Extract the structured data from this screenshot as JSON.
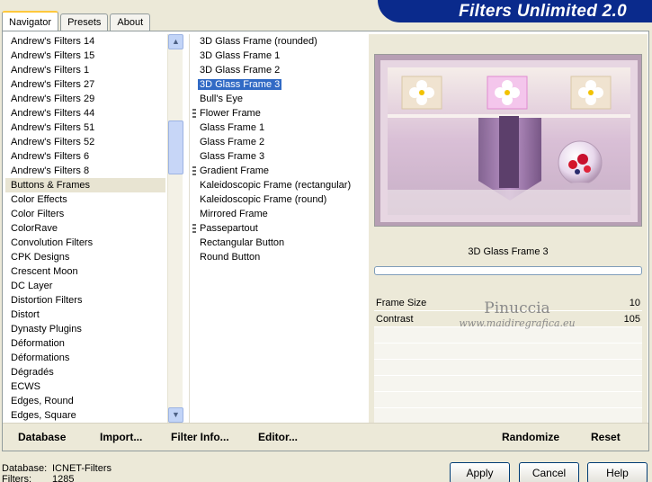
{
  "tabs": [
    "Navigator",
    "Presets",
    "About"
  ],
  "banner_title": "Filters Unlimited 2.0",
  "categories": [
    "Andrew's Filters 14",
    "Andrew's Filters 15",
    "Andrew's Filters 1",
    "Andrew's Filters 27",
    "Andrew's Filters 29",
    "Andrew's Filters 44",
    "Andrew's Filters 51",
    "Andrew's Filters 52",
    "Andrew's Filters 6",
    "Andrew's Filters 8",
    "Buttons & Frames",
    "Color Effects",
    "Color Filters",
    "ColorRave",
    "Convolution Filters",
    "CPK Designs",
    "Crescent Moon",
    "DC Layer",
    "Distortion Filters",
    "Distort",
    "Dynasty Plugins",
    "Déformation",
    "Déformations",
    "Dégradés",
    "ECWS",
    "Edges, Round",
    "Edges, Square"
  ],
  "selected_category_index": 10,
  "filters": [
    {
      "label": "3D Glass Frame (rounded)",
      "group": false
    },
    {
      "label": "3D Glass Frame 1",
      "group": false
    },
    {
      "label": "3D Glass Frame 2",
      "group": false
    },
    {
      "label": "3D Glass Frame 3",
      "group": false,
      "selected": true
    },
    {
      "label": "Bull's Eye",
      "group": false
    },
    {
      "label": "Flower Frame",
      "group": true
    },
    {
      "label": "Glass Frame 1",
      "group": false
    },
    {
      "label": "Glass Frame 2",
      "group": false
    },
    {
      "label": "Glass Frame 3",
      "group": false
    },
    {
      "label": "Gradient Frame",
      "group": true
    },
    {
      "label": "Kaleidoscopic Frame (rectangular)",
      "group": false
    },
    {
      "label": "Kaleidoscopic Frame (round)",
      "group": false
    },
    {
      "label": "Mirrored Frame",
      "group": false
    },
    {
      "label": "Passepartout",
      "group": true
    },
    {
      "label": "Rectangular Button",
      "group": false
    },
    {
      "label": "Round Button",
      "group": false
    }
  ],
  "preview": {
    "filter_name": "3D Glass Frame 3"
  },
  "params": [
    {
      "name": "Frame Size",
      "value": "10"
    },
    {
      "name": "Contrast",
      "value": "105"
    }
  ],
  "watermark": {
    "line1": "Pinuccia",
    "line2": "www.maidiregrafica.eu"
  },
  "bottom_links": {
    "database": "Database",
    "import": "Import...",
    "filter_info": "Filter Info...",
    "editor": "Editor...",
    "randomize": "Randomize",
    "reset": "Reset"
  },
  "status": {
    "database_label": "Database:",
    "database_value": "ICNET-Filters",
    "filters_label": "Filters:",
    "filters_value": "1285"
  },
  "buttons": {
    "apply": "Apply",
    "cancel": "Cancel",
    "help": "Help"
  },
  "colors": {
    "banner": "#0a2a8c",
    "selection": "#316ac5"
  }
}
